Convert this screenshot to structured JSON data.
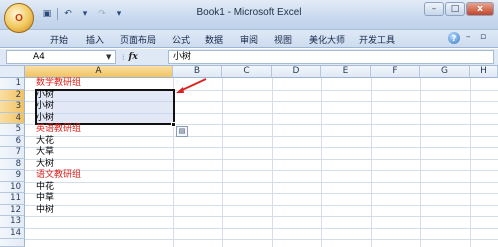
{
  "window": {
    "title": "Book1 - Microsoft Excel",
    "office_button_label": "O",
    "controls": {
      "minimize": "–",
      "maximize": "□",
      "close": "x"
    }
  },
  "quick_access": {
    "save_icon": "save-icon",
    "undo_icon": "undo-icon",
    "redo_icon": "redo-icon"
  },
  "ribbon": {
    "tabs": [
      "开始",
      "插入",
      "页面布局",
      "公式",
      "数据",
      "审阅",
      "视图",
      "美化大师",
      "开发工具"
    ],
    "help": "?",
    "minimize_ribbon": "–",
    "restore": "▫"
  },
  "formula_bar": {
    "name_box": "A4",
    "fx_label": "fx",
    "content": "小树"
  },
  "grid": {
    "columns": [
      "A",
      "B",
      "C",
      "D",
      "E",
      "F",
      "G",
      "H"
    ],
    "selected_column": "A",
    "rows": [
      "1",
      "2",
      "3",
      "4",
      "5",
      "6",
      "7",
      "8",
      "9",
      "10",
      "11",
      "12",
      "13",
      "14"
    ],
    "selected_rows": [
      "2",
      "3",
      "4"
    ],
    "cells": [
      {
        "row": 1,
        "text": "数学教研组",
        "color": "#e0221c"
      },
      {
        "row": 2,
        "text": "小树"
      },
      {
        "row": 3,
        "text": "小树"
      },
      {
        "row": 4,
        "text": "小树"
      },
      {
        "row": 5,
        "text": "英语教研组",
        "color": "#e0221c"
      },
      {
        "row": 6,
        "text": "大花"
      },
      {
        "row": 7,
        "text": "大草"
      },
      {
        "row": 8,
        "text": "大树"
      },
      {
        "row": 9,
        "text": "语文教研组",
        "color": "#e0221c"
      },
      {
        "row": 10,
        "text": "中花"
      },
      {
        "row": 11,
        "text": "中草"
      },
      {
        "row": 12,
        "text": "中树"
      }
    ],
    "selection": "A2:A4",
    "active_cell": "A4",
    "paste_options_icon": "paste-options-icon"
  },
  "colors": {
    "accent_red": "#e0221c",
    "header_selected": "#f2c261",
    "ribbon_blue": "#cedcef"
  }
}
